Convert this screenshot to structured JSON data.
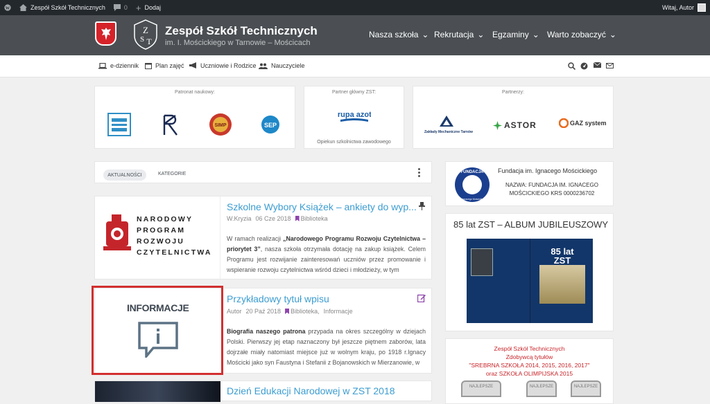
{
  "admin_bar": {
    "site_name": "Zespół Szkół Technicznych",
    "comments_count": "0",
    "add_label": "Dodaj",
    "greeting": "Witaj, Autor"
  },
  "header": {
    "title": "Zespół Szkół Technicznych",
    "subtitle": "im. I. Mościckiego w Tarnowie – Mościcach",
    "nav": [
      "Nasza szkoła",
      "Rekrutacja",
      "Egzaminy",
      "Warto zobaczyć"
    ]
  },
  "subnav": {
    "items": [
      "e-dziennik",
      "Plan zajęć",
      "Uczniowie i Rodzice",
      "Nauczyciele"
    ]
  },
  "partners": {
    "patronat_label": "Patronat naukowy:",
    "main_label": "Partner główny ZST:",
    "main_caption": "Opiekun szkolnictwa zawodowego",
    "partners_label": "Partnerzy:",
    "logo_grupa": "grupa azoty",
    "logo_zaklady": "Zakłady Mechaniczne Tarnów",
    "logo_astor": "ASTOR",
    "logo_gaz": "GAZ system",
    "logo_simp": "SIMP",
    "logo_sep": "SEP"
  },
  "feed": {
    "tabs": [
      "AKTUALNOŚCI",
      "KATEGORIE"
    ]
  },
  "posts": [
    {
      "title": "Szkolne Wybory Książek – ankiety do wyp...",
      "author": "W.Kryzia",
      "date": "06 Cze 2018",
      "category": "Biblioteka",
      "excerpt_lead": "W ramach realizacji",
      "excerpt_bold": "„Narodowego Programu Rozwoju Czytelnictwa – priorytet 3”",
      "excerpt_rest": ", nasza szkoła otrzymała dotację na zakup książek. Celem Programu jest rozwijanie zainteresowań uczniów przez promowanie i wspieranie rozwoju czytelnictwa wśród dzieci i młodzieży, w tym",
      "image_lines": [
        "NARODOWY",
        "PROGRAM",
        "ROZWOJU",
        "CZYTELNICTWA"
      ]
    },
    {
      "title": "Przykładowy tytuł wpisu",
      "author": "Autor",
      "date": "20 Paź 2018",
      "category": "Biblioteka,",
      "category2": "Informacje",
      "excerpt_bold": "Biografia naszego patrona",
      "excerpt_rest": " przypada na okres szczególny w dziejach Polski. Pierwszy jej etap naznaczony był jeszcze piętnem zaborów, lata dojrzałe miały natomiast miejsce już w wolnym kraju, po 1918 r.Ignacy Mościcki jako syn Faustyna i Stefanii z Bojanowskich w Mierzanowie, w",
      "image_label": "INFORMACJE"
    },
    {
      "title": "Dzień Edukacji Narodowej w ZST 2018"
    }
  ],
  "sidebar": {
    "fundacja_title": "Fundacja im. Ignacego Mościckiego",
    "fundacja_text": "NAZWA: FUNDACJA IM. IGNACEGO MOŚCICKIEGO KRS 0000236702",
    "fundacja_logo": "FUNDACJA",
    "fundacja_logo_sub": "im. Ignacego Mościckiego",
    "album_title": "85 lat ZST – ALBUM JUBILEUSZOWY",
    "album_cover": "85 lat ZST",
    "award_lines": [
      "Zespół Szkół Technicznych",
      "Zdobywcą tytułów",
      "\"SREBRNA SZKOŁA 2014, 2015, 2016, 2017\"",
      "oraz SZKOŁA OLIMPIJSKA 2015"
    ],
    "badges": [
      "NAJLEPSZE",
      "NAJLEPSZE",
      "NAJLEPSZE"
    ]
  },
  "colors": {
    "accent": "#3c9dd1",
    "header": "#4b4f53",
    "admin": "#23282d",
    "highlight": "#d32f2f",
    "award": "#c82429"
  }
}
